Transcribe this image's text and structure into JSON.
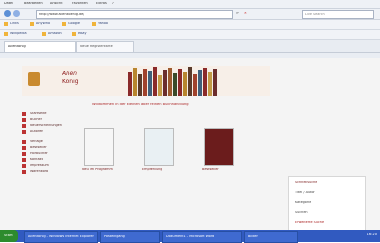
{
  "browser": {
    "menu": [
      "Datei",
      "Bearbeiten",
      "Ansicht",
      "Favoriten",
      "Extras",
      "?"
    ],
    "url": "http://www.alienkoenig.de/",
    "search_placeholder": "Live Search",
    "bookmarks": [
      "Links",
      "AnyWho",
      "Google",
      "Yahoo",
      "Wikipedia",
      "Amazon",
      "eBay"
    ],
    "tabs": [
      "Alienkönig",
      "Neue Registerkarte"
    ]
  },
  "site": {
    "brand_line1": "Alien",
    "brand_line2": "König",
    "welcome": "Willkommen in der kleinen aber feinen Buchhandlung",
    "nav": [
      "Startseite",
      "Bücher",
      "Neuerscheinungen",
      "Autoren",
      "Verlage",
      "Bestseller",
      "Hörbücher",
      "Kontakt",
      "Impressum",
      "Warenkorb"
    ],
    "featured_captions": [
      "Neu im Programm",
      "Empfehlung",
      "Bestseller"
    ],
    "sidebox_title": "Schnellsuche",
    "sidebox_lines": [
      "Titel / Autor",
      "Kategorie",
      "Suchen",
      "Erweiterte Suche"
    ]
  },
  "taskbar": {
    "start_label": "Start",
    "items": [
      "Alienkönig - Windows Internet Explorer",
      "Posteingang",
      "Dokument1 - Microsoft Word",
      "Bilder"
    ],
    "clock": "16:20"
  }
}
